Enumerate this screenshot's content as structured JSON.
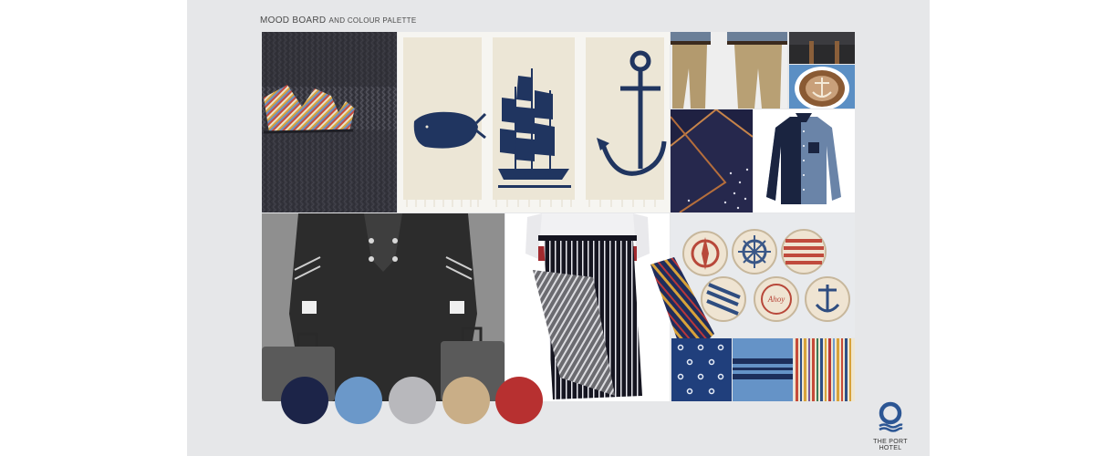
{
  "heading": {
    "main": "MOOD BOARD",
    "sub": "AND COLOUR PALETTE"
  },
  "palette": [
    {
      "name": "navy",
      "color": "#1c2448"
    },
    {
      "name": "steel-blue",
      "color": "#6b98c9"
    },
    {
      "name": "silver-grey",
      "color": "#b8b8bc"
    },
    {
      "name": "sand",
      "color": "#c9ae87"
    },
    {
      "name": "red",
      "color": "#b73030"
    }
  ],
  "logo": {
    "label": "THE PORT HOTEL",
    "color": "#2c5694"
  },
  "buttons": {
    "ahoy": "Ahoy"
  }
}
